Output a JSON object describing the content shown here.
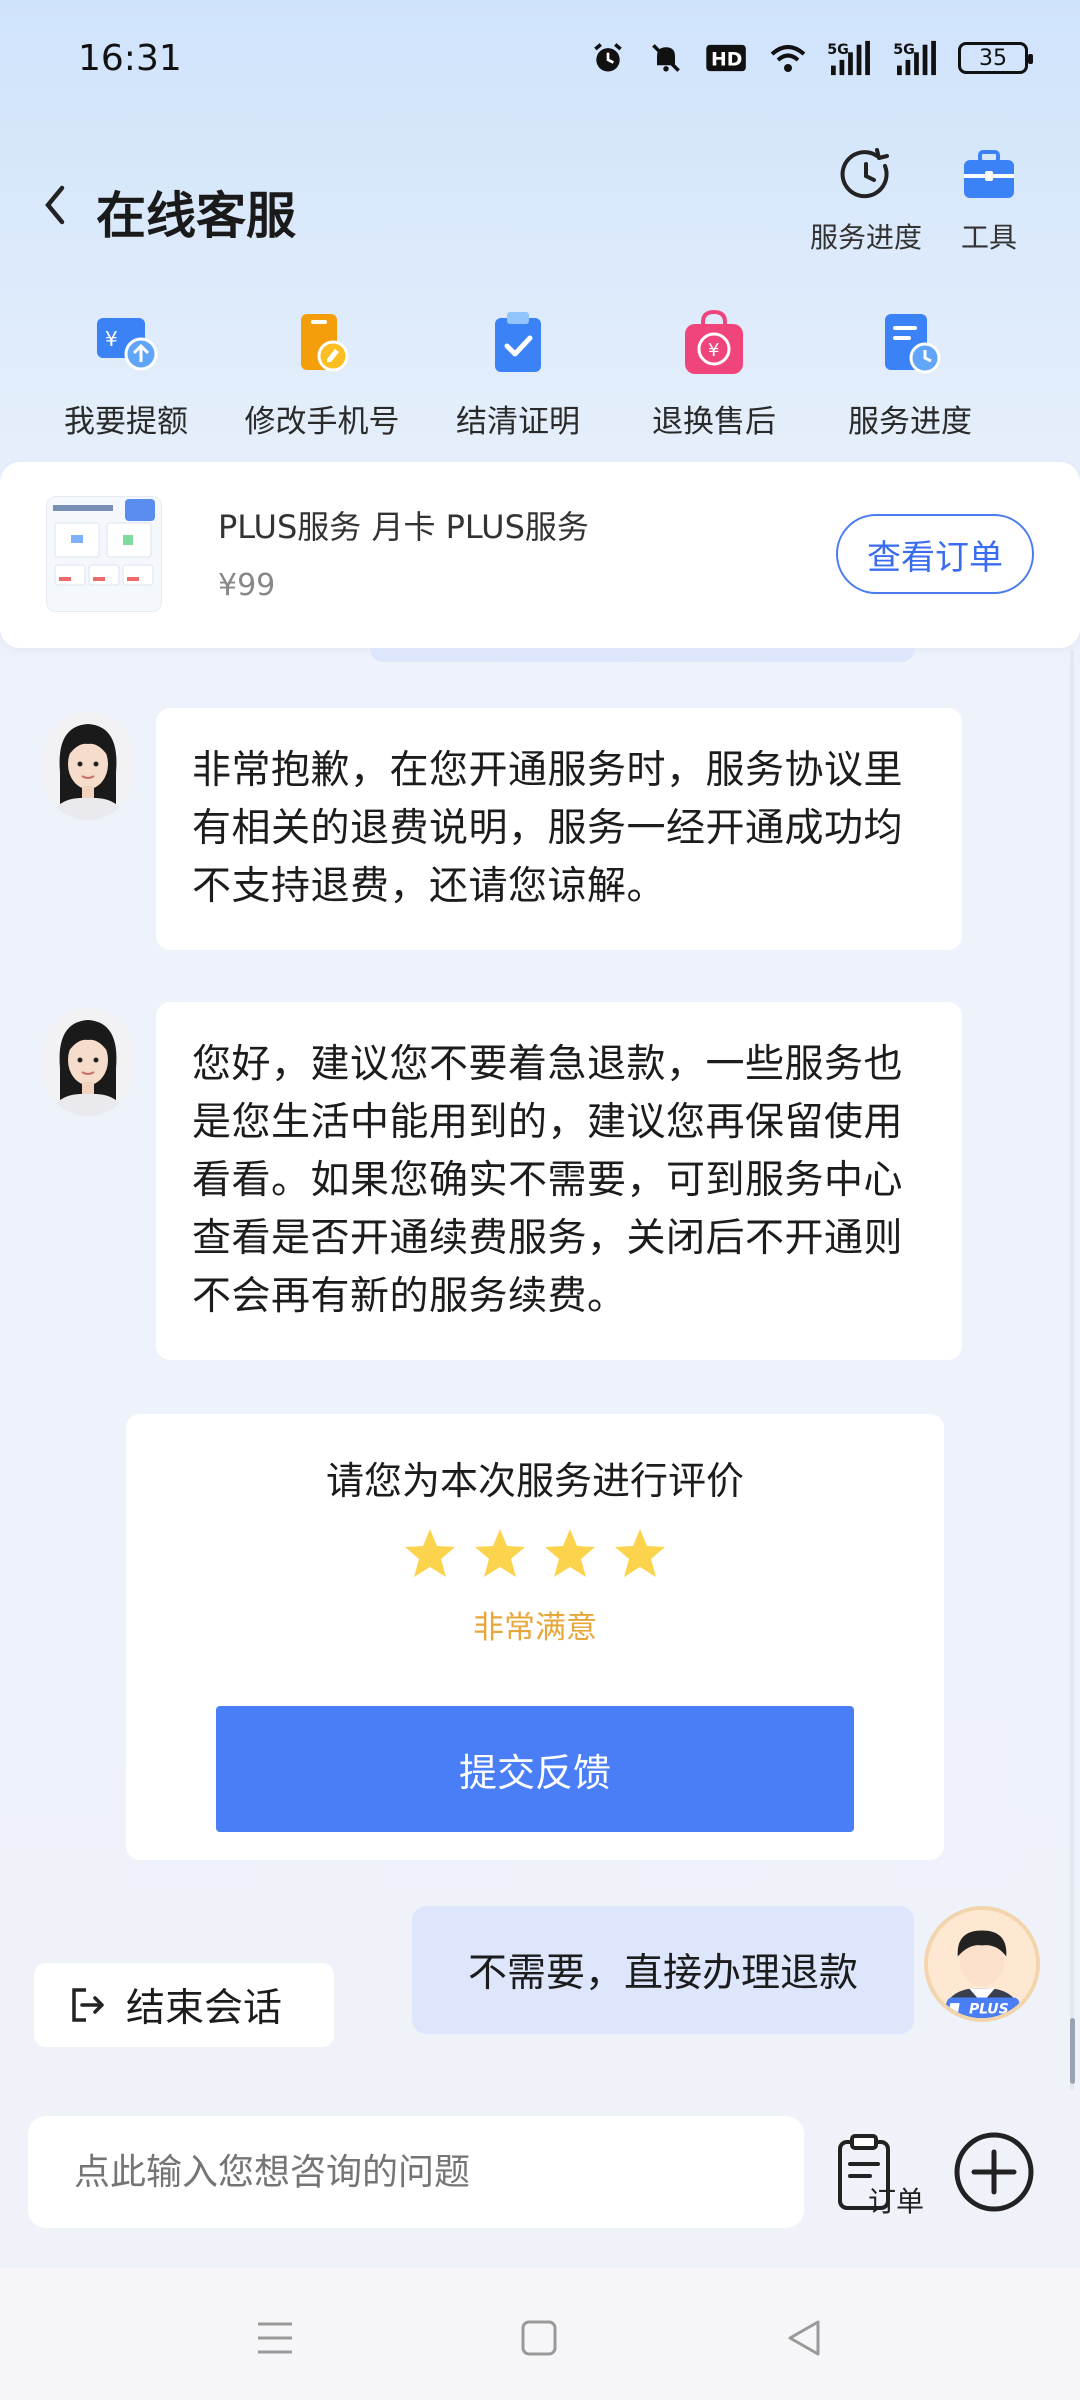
{
  "status_bar": {
    "time": "16:31",
    "network_label": "HD",
    "signal_1": "5G",
    "signal_2": "5G",
    "battery": "35",
    "icons": [
      "alarm-icon",
      "mute-icon",
      "hd-icon",
      "wifi-icon",
      "signal-icon",
      "signal-icon",
      "battery-icon"
    ]
  },
  "header": {
    "title": "在线客服",
    "actions": [
      {
        "label": "服务进度",
        "icon": "clock-icon"
      },
      {
        "label": "工具",
        "icon": "toolbox-icon"
      }
    ]
  },
  "quick_actions": [
    {
      "label": "我要提额",
      "icon": "wallet-up-icon",
      "color": "#3b82f6"
    },
    {
      "label": "修改手机号",
      "icon": "phone-edit-icon",
      "color": "#f59e0b"
    },
    {
      "label": "结清证明",
      "icon": "clipboard-check-icon",
      "color": "#3b82f6"
    },
    {
      "label": "退换售后",
      "icon": "refund-bag-icon",
      "color": "#f0457a"
    },
    {
      "label": "服务进度",
      "icon": "doc-clock-icon",
      "color": "#3b82f6"
    }
  ],
  "order": {
    "name": "PLUS服务 月卡 PLUS服务",
    "price": "¥99",
    "button": "查看订单"
  },
  "messages": [
    {
      "from": "agent",
      "text": "非常抱歉，在您开通服务时，服务协议里有相关的退费说明，服务一经开通成功均不支持退费，还请您谅解。"
    },
    {
      "from": "agent",
      "text": "您好，建议您不要着急退款，一些服务也是您生活中能用到的，建议您再保留使用看看。如果您确实不需要，可到服务中心查看是否开通续费服务，关闭后不开通则不会再有新的服务续费。"
    },
    {
      "from": "user",
      "text": "不需要，直接办理退款"
    }
  ],
  "rating": {
    "title": "请您为本次服务进行评价",
    "stars": 4,
    "star_color": "#fcd34d",
    "label": "非常满意",
    "submit": "提交反馈"
  },
  "user_badge": "PLUS",
  "end_chat": "结束会话",
  "input": {
    "placeholder": "点此输入您想咨询的问题",
    "order_label": "订单"
  },
  "accent_color": "#4a7ef7"
}
